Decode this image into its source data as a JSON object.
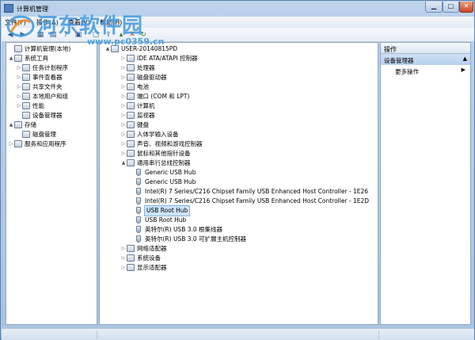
{
  "window": {
    "title": "计算机管理"
  },
  "watermark": {
    "text": "河东软件园",
    "url": "www.pc0359.cn"
  },
  "menubar": {
    "items": [
      "文件(F)",
      "操作(A)",
      "查看(V)",
      "帮助(H)"
    ]
  },
  "left_tree": {
    "items": [
      {
        "label": "计算机管理(本地)",
        "level": 0,
        "expander": ""
      },
      {
        "label": "系统工具",
        "level": 0,
        "expander": "▲"
      },
      {
        "label": "任务计划程序",
        "level": 1,
        "expander": "▷"
      },
      {
        "label": "事件查看器",
        "level": 1,
        "expander": "▷"
      },
      {
        "label": "共享文件夹",
        "level": 1,
        "expander": "▷"
      },
      {
        "label": "本地用户和组",
        "level": 1,
        "expander": "▷"
      },
      {
        "label": "性能",
        "level": 1,
        "expander": "▷"
      },
      {
        "label": "设备管理器",
        "level": 1,
        "expander": ""
      },
      {
        "label": "存储",
        "level": 0,
        "expander": "▲"
      },
      {
        "label": "磁盘管理",
        "level": 1,
        "expander": ""
      },
      {
        "label": "服务和应用程序",
        "level": 0,
        "expander": "▷"
      }
    ]
  },
  "device_tree": {
    "root": "USER-20140815PD",
    "items": [
      {
        "label": "IDE ATA/ATAPI 控制器",
        "level": 1,
        "expander": "▷"
      },
      {
        "label": "处理器",
        "level": 1,
        "expander": "▷"
      },
      {
        "label": "磁盘驱动器",
        "level": 1,
        "expander": "▷"
      },
      {
        "label": "电池",
        "level": 1,
        "expander": "▷"
      },
      {
        "label": "端口 (COM 和 LPT)",
        "level": 1,
        "expander": "▷"
      },
      {
        "label": "计算机",
        "level": 1,
        "expander": "▷"
      },
      {
        "label": "监视器",
        "level": 1,
        "expander": "▷"
      },
      {
        "label": "键盘",
        "level": 1,
        "expander": "▷"
      },
      {
        "label": "人体学输入设备",
        "level": 1,
        "expander": "▷"
      },
      {
        "label": "声音、视频和游戏控制器",
        "level": 1,
        "expander": "▷"
      },
      {
        "label": "鼠标和其他指针设备",
        "level": 1,
        "expander": "▷"
      },
      {
        "label": "通用串行总线控制器",
        "level": 1,
        "expander": "▲"
      },
      {
        "label": "Generic USB Hub",
        "level": 2,
        "expander": ""
      },
      {
        "label": "Generic USB Hub",
        "level": 2,
        "expander": ""
      },
      {
        "label": "Intel(R) 7 Series/C216 Chipset Family USB Enhanced Host Controller - 1E26",
        "level": 2,
        "expander": ""
      },
      {
        "label": "Intel(R) 7 Series/C216 Chipset Family USB Enhanced Host Controller - 1E2D",
        "level": 2,
        "expander": ""
      },
      {
        "label": "USB Root Hub",
        "level": 2,
        "expander": "",
        "selected": true
      },
      {
        "label": "USB Root Hub",
        "level": 2,
        "expander": ""
      },
      {
        "label": "英特尔(R) USB 3.0 根集线器",
        "level": 2,
        "expander": ""
      },
      {
        "label": "英特尔(R) USB 3.0 可扩展主机控制器",
        "level": 2,
        "expander": ""
      },
      {
        "label": "网络适配器",
        "level": 1,
        "expander": "▷"
      },
      {
        "label": "系统设备",
        "level": 1,
        "expander": "▷"
      },
      {
        "label": "显示适配器",
        "level": 1,
        "expander": "▷"
      }
    ]
  },
  "actions_pane": {
    "header": "操作",
    "section": "设备管理器",
    "more": "更多操作"
  },
  "colors": {
    "selection": "#cde4fb",
    "watermark": "#4096de"
  }
}
